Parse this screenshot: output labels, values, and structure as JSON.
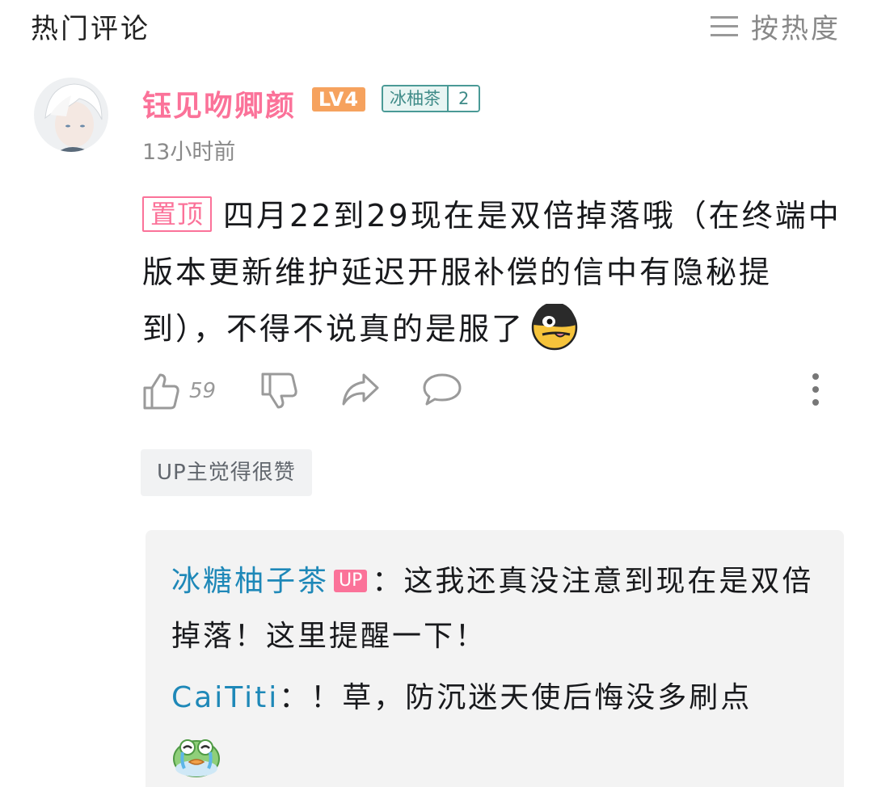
{
  "header": {
    "title": "热门评论",
    "sort_label": "按热度",
    "sort_icon": "menu-lines-icon"
  },
  "comment": {
    "username": "钰见吻卿颜",
    "level": "LV4",
    "fan_badge": {
      "name": "冰柚茶",
      "level": "2",
      "color": "#4a9a96"
    },
    "time": "13小时前",
    "pinned_label": "置顶",
    "text": "四月22到29现在是双倍掉落哦（在终端中版本更新维护延迟开服补偿的信中有隐秘提到），不得不说真的是服了",
    "emoji": "doge-face-emoji",
    "likes": "59",
    "up_liked_label": "UP主觉得很赞"
  },
  "replies": [
    {
      "user": "冰糖柚子茶",
      "badge": "UP",
      "text": "：这我还真没注意到现在是双倍掉落！这里提醒一下！"
    },
    {
      "user": "CaiTiti",
      "badge": "",
      "text": "：！草，防沉迷天使后悔没多刷点",
      "emoji": "crying-frog-emoji"
    }
  ],
  "colors": {
    "accent": "#fb7299",
    "level_badge": "#f6a25e",
    "reply_name": "#1e88b8",
    "muted": "#8a8a8a"
  }
}
